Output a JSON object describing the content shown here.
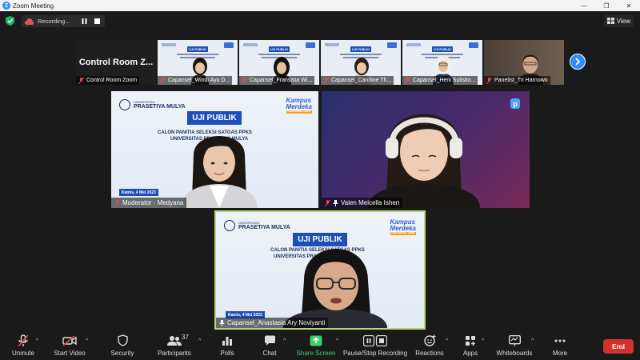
{
  "window": {
    "title": "Zoom Meeting",
    "logo_letter": "Z",
    "minimize": "—",
    "maximize": "❐",
    "close": "✕"
  },
  "topbar": {
    "recording_label": "Recording...",
    "view_label": "View"
  },
  "strip": {
    "host_tile_text": "Control Room Z...",
    "tiles": [
      {
        "name": "Control Room Zoom"
      },
      {
        "name": "Capansel_Windi Ayu D..."
      },
      {
        "name": "Capansel_Fransista Wi..."
      },
      {
        "name": "Capansel_Caroline Th..."
      },
      {
        "name": "Capansel_Heni Sulistio..."
      },
      {
        "name": "Panelist_Tri Harnowo"
      }
    ],
    "mini_banner": "UJI PUBLIK"
  },
  "tiles": {
    "moderator": {
      "name": "Moderator - Medyana",
      "uni_small": "UNIVERSITAS",
      "uni_name": "PRASETIYA MULYA",
      "km_line1": "Kampus",
      "km_line2": "Merdeka",
      "km_tag": "INDONESIA JAYA",
      "banner": "UJI PUBLIK",
      "sub1": "CALON PANITIA SELEKSI SATGAS PPKS",
      "sub2": "UNIVERSITAS PRASETIYA MULYA",
      "date": "Kamis, 4 Mei 2023"
    },
    "valen": {
      "name": "Valen Meicella Ishen",
      "logo": "p"
    },
    "anastasia": {
      "name": "Capansel_Anastasia Ary Noviyanti",
      "uni_small": "UNIVERSITAS",
      "uni_name": "PRASETIYA MULYA",
      "km_line1": "Kampus",
      "km_line2": "Merdeka",
      "km_tag": "INDONESIA JAYA",
      "banner": "UJI PUBLIK",
      "sub1": "CALON PANITIA SELEKSI SATGAS PPKS",
      "sub2": "UNIVERSITAS PRASETIYA MULYA",
      "date": "Kamis, 4 Mei 2023"
    }
  },
  "toolbar": {
    "unmute": "Unmute",
    "start_video": "Start Video",
    "security": "Security",
    "participants": "Participants",
    "participants_count": "37",
    "polls": "Polls",
    "chat": "Chat",
    "share_screen": "Share Screen",
    "pause_stop_recording": "Pause/Stop Recording",
    "reactions": "Reactions",
    "apps": "Apps",
    "whiteboards": "Whiteboards",
    "more": "More",
    "end": "End",
    "caret": "^"
  },
  "colors": {
    "accent_blue": "#2d8cff",
    "share_green": "#3ad16b",
    "end_red": "#d0312d",
    "speaker_border": "#b9d97a"
  },
  "icons": [
    "shield-icon",
    "cloud-record-icon",
    "pause-icon",
    "stop-icon",
    "grid-view-icon",
    "mic-off-icon",
    "video-off-icon",
    "security-shield-icon",
    "participants-icon",
    "polls-icon",
    "chat-icon",
    "share-screen-icon",
    "pause-stop-recording-icon",
    "reactions-icon",
    "apps-icon",
    "whiteboards-icon",
    "more-icon",
    "chevron-right-icon"
  ]
}
